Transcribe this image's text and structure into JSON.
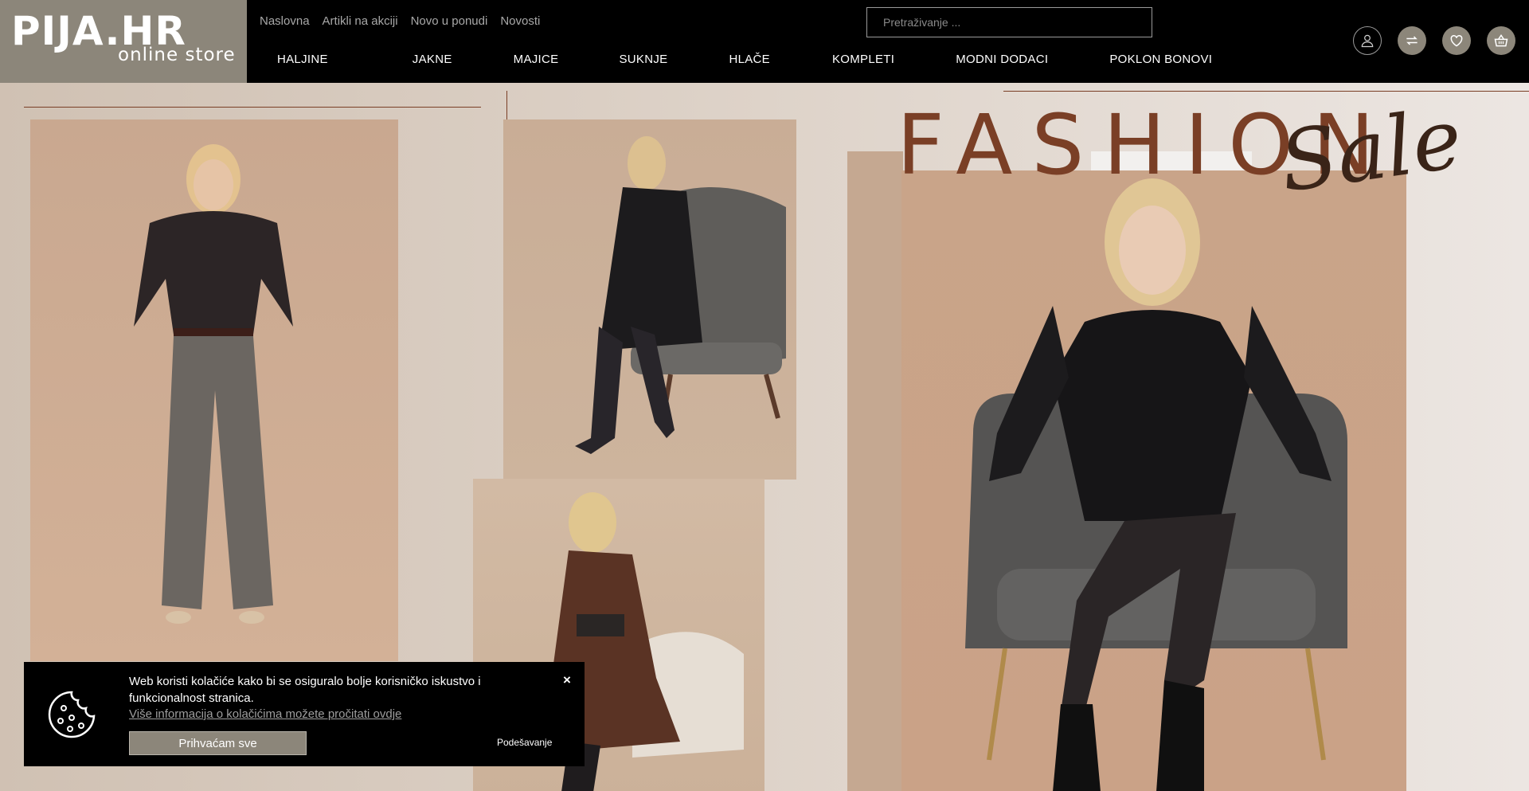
{
  "brand": {
    "name": "PIJA.HR",
    "tagline": "online store"
  },
  "top_nav": [
    "Naslovna",
    "Artikli na akciji",
    "Novo u ponudi",
    "Novosti"
  ],
  "search": {
    "placeholder": "Pretraživanje ..."
  },
  "main_nav": [
    "HALJINE",
    "JAKNE",
    "MAJICE",
    "SUKNJE",
    "HLAČE",
    "KOMPLETI",
    "MODNI DODACI",
    "POKLON BONOVI"
  ],
  "header_icons": [
    "user-icon",
    "compare-icon",
    "heart-icon",
    "basket-icon"
  ],
  "hero": {
    "headline": "FASHION",
    "script": "Sale"
  },
  "cookie_banner": {
    "text": "Web koristi kolačiće kako bi se osiguralo bolje korisničko iskustvo i funkcionalnost stranica.",
    "link": "Više informacija o kolačićima možete pročitati ovdje",
    "accept": "Prihvaćam sve",
    "settings": "Podešavanje",
    "close": "×"
  },
  "colors": {
    "header_bg": "#000000",
    "logo_bg": "#8c867a",
    "accent_brown": "#7a3f26",
    "hero_bg": "#d6c9bd"
  }
}
